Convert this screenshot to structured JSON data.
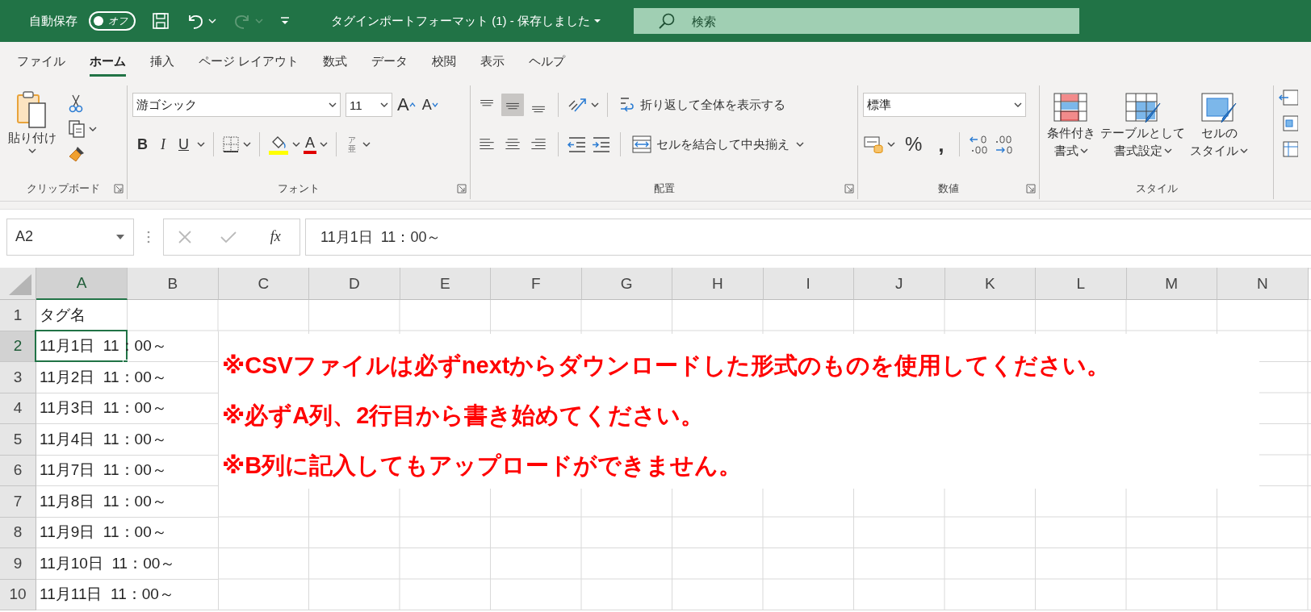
{
  "title_bar": {
    "autosave_label": "自動保存",
    "autosave_toggle": {
      "label": "オフ",
      "on": false
    },
    "undo_enabled": true,
    "redo_enabled": false,
    "document_title": "タグインポートフォーマット (1) -  保存しました",
    "search": {
      "placeholder": "検索"
    }
  },
  "tabs": [
    {
      "label": "ファイル",
      "selected": false
    },
    {
      "label": "ホーム",
      "selected": true
    },
    {
      "label": "挿入",
      "selected": false
    },
    {
      "label": "ページ レイアウト",
      "selected": false
    },
    {
      "label": "数式",
      "selected": false
    },
    {
      "label": "データ",
      "selected": false
    },
    {
      "label": "校閲",
      "selected": false
    },
    {
      "label": "表示",
      "selected": false
    },
    {
      "label": "ヘルプ",
      "selected": false
    }
  ],
  "ribbon": {
    "groups": [
      {
        "kind": "clipboard",
        "label": "クリップボード",
        "paste_label": "貼り付け"
      },
      {
        "kind": "font",
        "label": "フォント",
        "font_name": "游ゴシック",
        "font_size": "11",
        "grow_label": "A",
        "shrink_label": "A",
        "bold_label": "B",
        "italic_label": "I",
        "underline_label": "U",
        "font_color_label": "A",
        "phonetic_top": "ア",
        "phonetic_bottom": "亜"
      },
      {
        "kind": "alignment",
        "label": "配置",
        "vertical_align": [
          {
            "selected": false
          },
          {
            "selected": true
          },
          {
            "selected": false
          }
        ],
        "horizontal_align": [
          {
            "selected": false
          },
          {
            "selected": false
          },
          {
            "selected": false
          }
        ],
        "wrap_label": "折り返して全体を表示する",
        "merge_label": "セルを結合して中央揃え"
      },
      {
        "kind": "number",
        "label": "数値",
        "format": "標準",
        "percent_label": "%",
        "comma_label": ","
      },
      {
        "kind": "styles",
        "label": "スタイル",
        "buttons": [
          {
            "kind": "conditional",
            "lines": [
              "条件付き",
              "書式"
            ]
          },
          {
            "kind": "table",
            "lines": [
              "テーブルとして",
              "書式設定"
            ]
          },
          {
            "kind": "cellstyle",
            "lines": [
              "セルの",
              "スタイル"
            ]
          }
        ]
      },
      {
        "kind": "cells_partial"
      }
    ]
  },
  "formula_bar": {
    "name_box": "A2",
    "function_label": "fx",
    "value": "11月1日  11：00～"
  },
  "sheet": {
    "columns": [
      {
        "label": "A",
        "selected": true
      },
      {
        "label": "B",
        "selected": false
      },
      {
        "label": "C",
        "selected": false
      },
      {
        "label": "D",
        "selected": false
      },
      {
        "label": "E",
        "selected": false
      },
      {
        "label": "F",
        "selected": false
      },
      {
        "label": "G",
        "selected": false
      },
      {
        "label": "H",
        "selected": false
      },
      {
        "label": "I",
        "selected": false
      },
      {
        "label": "J",
        "selected": false
      },
      {
        "label": "K",
        "selected": false
      },
      {
        "label": "L",
        "selected": false
      },
      {
        "label": "M",
        "selected": false
      },
      {
        "label": "N",
        "selected": false
      }
    ],
    "rows": [
      {
        "number": "1",
        "selected": false,
        "cells": [
          {
            "text": "タグ名",
            "selected": false
          }
        ]
      },
      {
        "number": "2",
        "selected": true,
        "cells": [
          {
            "text": "11月1日  11：00～",
            "selected": true
          }
        ]
      },
      {
        "number": "3",
        "selected": false,
        "cells": [
          {
            "text": "11月2日  11：00～",
            "selected": false
          }
        ]
      },
      {
        "number": "4",
        "selected": false,
        "cells": [
          {
            "text": "11月3日  11：00～",
            "selected": false
          }
        ]
      },
      {
        "number": "5",
        "selected": false,
        "cells": [
          {
            "text": "11月4日  11：00～",
            "selected": false
          }
        ]
      },
      {
        "number": "6",
        "selected": false,
        "cells": [
          {
            "text": "11月7日  11：00～",
            "selected": false
          }
        ]
      },
      {
        "number": "7",
        "selected": false,
        "cells": [
          {
            "text": "11月8日  11：00～",
            "selected": false
          }
        ]
      },
      {
        "number": "8",
        "selected": false,
        "cells": [
          {
            "text": "11月9日  11：00～",
            "selected": false
          }
        ]
      },
      {
        "number": "9",
        "selected": false,
        "cells": [
          {
            "text": "11月10日  11：00～",
            "selected": false
          }
        ]
      },
      {
        "number": "10",
        "selected": false,
        "cells": [
          {
            "text": "11月11日  11：00～",
            "selected": false
          }
        ]
      }
    ]
  },
  "notice": {
    "lines": [
      "※CSVファイルは必ずnextからダウンロードした形式のものを使用してください。",
      "※必ずA列、2行目から書き始めてください。",
      "※B列に記入してもアップロードができません。"
    ]
  }
}
